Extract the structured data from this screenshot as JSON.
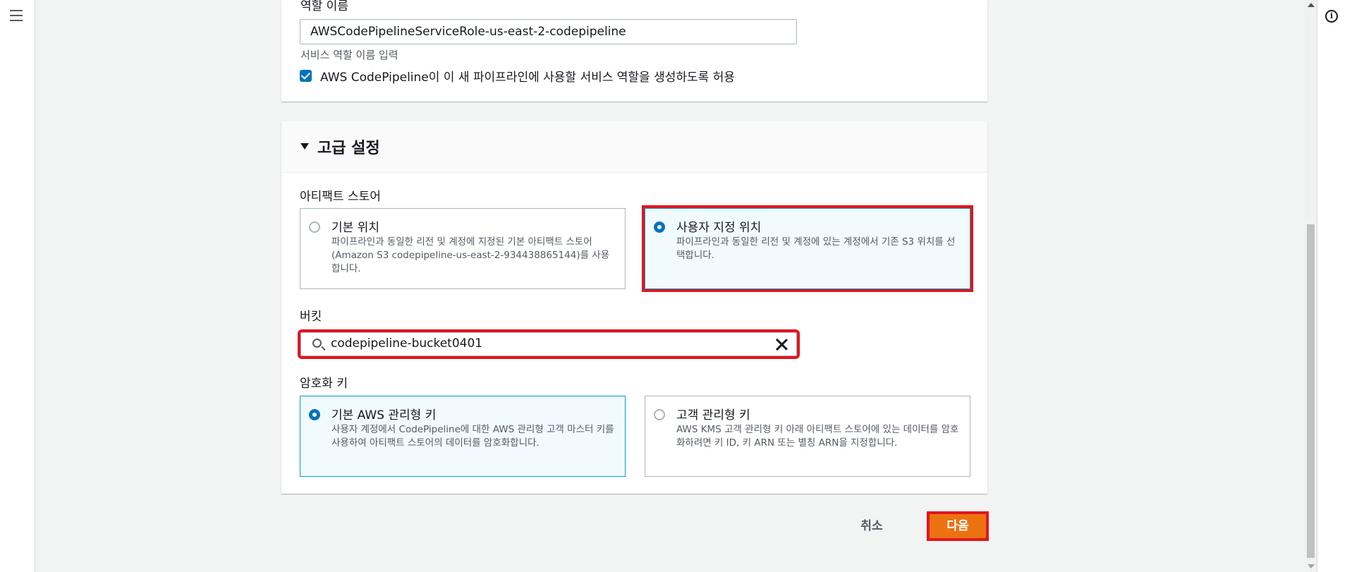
{
  "role_section": {
    "label": "역할 이름",
    "role_name_value": "AWSCodePipelineServiceRole-us-east-2-codepipeline",
    "hint": "서비스 역할 이름 입력",
    "allow_checkbox_label": "AWS CodePipeline이 이 새 파이프라인에 사용할 서비스 역할을 생성하도록 허용",
    "allow_checked": true
  },
  "advanced": {
    "title": "고급 설정",
    "artifact_store": {
      "label": "아티팩트 스토어",
      "options": [
        {
          "title": "기본 위치",
          "description": "파이프라인과 동일한 리전 및 계정에 지정된 기본 아티팩트 스토어(Amazon S3 codepipeline-us-east-2-934438865144)를 사용합니다.",
          "selected": false
        },
        {
          "title": "사용자 지정 위치",
          "description": "파이프라인과 동일한 리전 및 계정에 있는 계정에서 기존 S3 위치를 선택합니다.",
          "selected": true
        }
      ]
    },
    "bucket": {
      "label": "버킷",
      "value": "codepipeline-bucket0401"
    },
    "encryption_key": {
      "label": "암호화 키",
      "options": [
        {
          "title": "기본 AWS 관리형 키",
          "description": "사용자 계정에서 CodePipeline에 대한 AWS 관리형 고객 마스터 키를 사용하여 아티팩트 스토어의 데이터를 암호화합니다.",
          "selected": true
        },
        {
          "title": "고객 관리형 키",
          "description": "AWS KMS 고객 관리형 키 아래 아티팩트 스토어에 있는 데이터를 암호화하려면 키 ID, 키 ARN 또는 별칭 ARN을 지정합니다.",
          "selected": false
        }
      ]
    }
  },
  "footer": {
    "cancel_label": "취소",
    "next_label": "다음"
  },
  "colors": {
    "primary_button": "#ec7211",
    "highlight_outline": "#e0161e",
    "radio_selected": "#0073bb",
    "tile_selected_border": "#00a1c9"
  },
  "icons": [
    "menu-icon",
    "info-icon",
    "caret-down-icon",
    "search-icon",
    "close-icon",
    "checkmark-icon"
  ]
}
